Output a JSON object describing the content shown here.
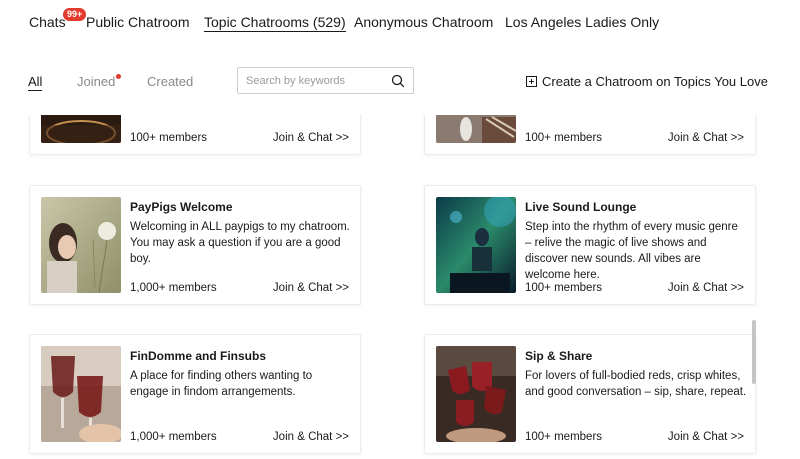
{
  "top_tabs": {
    "chats": "Chats",
    "chats_badge": "99+",
    "public": "Public Chatroom",
    "topic": "Topic Chatrooms (529)",
    "anonymous": "Anonymous Chatroom",
    "la": "Los Angeles Ladies Only"
  },
  "filters": {
    "all": "All",
    "joined": "Joined",
    "created": "Created"
  },
  "search": {
    "placeholder": "Search by keywords"
  },
  "create_label": "Create a Chatroom on Topics You Love",
  "cards": [
    {
      "title": "",
      "desc": "",
      "members": "100+ members",
      "join": "Join & Chat >>"
    },
    {
      "title": "",
      "desc": "",
      "members": "100+ members",
      "join": "Join & Chat >>"
    },
    {
      "title": "PayPigs Welcome",
      "desc": "Welcoming in ALL paypigs to my chatroom. You may ask a question if you are a good boy.",
      "members": "1,000+ members",
      "join": "Join & Chat >>"
    },
    {
      "title": "Live Sound Lounge",
      "desc": "Step into the rhythm of every music genre – relive the magic of live shows and discover new sounds. All vibes are welcome here.",
      "members": "100+ members",
      "join": "Join & Chat >>"
    },
    {
      "title": "FinDomme and Finsubs",
      "desc": "A place for finding others wanting to engage in findom arrangements.",
      "members": "1,000+ members",
      "join": "Join & Chat >>"
    },
    {
      "title": "Sip & Share",
      "desc": "For lovers of full-bodied reds, crisp whites, and good conversation – sip, share, repeat.",
      "members": "100+ members",
      "join": "Join & Chat >>"
    }
  ],
  "colors": {
    "badge": "#e23b2e",
    "border": "#ececec"
  }
}
